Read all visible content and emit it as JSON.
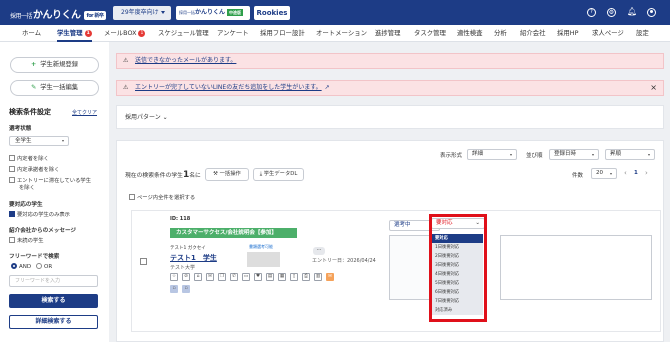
{
  "app": {
    "logo_small": "採用一括",
    "logo": "かんりくん",
    "logo_tag": "for 新卒",
    "year_selector": "29年度卒向け",
    "ad_banner_1": {
      "small": "採用一括",
      "main": "かんりくん",
      "tag": "中途版"
    },
    "ad_banner_2": "Rookies"
  },
  "header_icons": [
    "help-icon",
    "settings-icon",
    "notification-icon",
    "user-icon"
  ],
  "nav": [
    {
      "label": "ホーム"
    },
    {
      "label": "学生管理",
      "badge": "1",
      "active": true
    },
    {
      "label": "メールBOX",
      "badge": "1"
    },
    {
      "label": "スケジュール管理"
    },
    {
      "label": "アンケート"
    },
    {
      "label": "採用フロー設計"
    },
    {
      "label": "オートメーション"
    },
    {
      "label": "進捗管理"
    },
    {
      "label": "タスク管理"
    },
    {
      "label": "適性検査"
    },
    {
      "label": "分析"
    },
    {
      "label": "紹介会社"
    },
    {
      "label": "採用HP"
    },
    {
      "label": "求人ページ"
    },
    {
      "label": "設定"
    }
  ],
  "sidebar": {
    "new_student_button": "学生新規登録",
    "bulk_edit_button": "学生一括編集",
    "search_title": "検索条件設定",
    "clear_all": "全てクリア",
    "status_label": "選考状態",
    "status_value": "全学生",
    "checkboxes": [
      {
        "label": "内定者を除く",
        "checked": false
      },
      {
        "label": "内定承諾者を除く",
        "checked": false
      },
      {
        "label": "エントリーに滞在している学生",
        "label2": "を除く",
        "checked": false
      }
    ],
    "action_needed_label": "要対応の学生",
    "action_needed_checkbox": "要対応の学生のみ表示",
    "agency_message_label": "紹介会社からのメッセージ",
    "unread_checkbox": "未読の学生",
    "freeword_label": "フリーワードで検索",
    "and_label": "AND",
    "or_label": "OR",
    "freeword_placeholder": "フリーワードを入力",
    "search_button": "検索する",
    "detail_search_button": "詳細検索する"
  },
  "alerts": [
    {
      "text": "送信できなかったメールがあります。"
    },
    {
      "text": "エントリーが完了していないLINEの友だち追加をした学生がいます。"
    }
  ],
  "main": {
    "pattern_label": "採用パターン",
    "display_format_label": "表示形式",
    "display_format_value": "詳細",
    "sort_label": "並び順",
    "sort_value": "登録日時",
    "order_value": "昇順",
    "count_text_prefix": "現在の検索条件の学生",
    "count_number": "1",
    "count_text_suffix": "名に",
    "bulk_action_button": "一括操作",
    "student_dl_button": "学生データDL",
    "page_count_label": "件数",
    "page_count_value": "20",
    "page_number": "1",
    "select_all_label": "ページ内全件を選択する"
  },
  "student_card": {
    "id_label": "ID: 118",
    "event": "カスタマーサクセス/会社説明会【参加】",
    "kana": "テスト1 ガクセイ",
    "name": "テスト1　学生",
    "university": "テスト大学",
    "document_link": "書類選考可能",
    "entry_date": "エントリー日：2026/04/24",
    "flow_button": "...",
    "stage_select": "選考中"
  },
  "dropdown": {
    "selected": "要対応",
    "options": [
      "要対応",
      "1日後要対応",
      "2日後要対応",
      "3日後要対応",
      "4日後要対応",
      "5日後要対応",
      "6日後要対応",
      "7日後要対応",
      "対応済み"
    ]
  },
  "colors": {
    "primary": "#1d3c86",
    "highlight": "#e0101a",
    "event_bar": "#4caf6a",
    "alert_bg": "#fbe2e4"
  }
}
